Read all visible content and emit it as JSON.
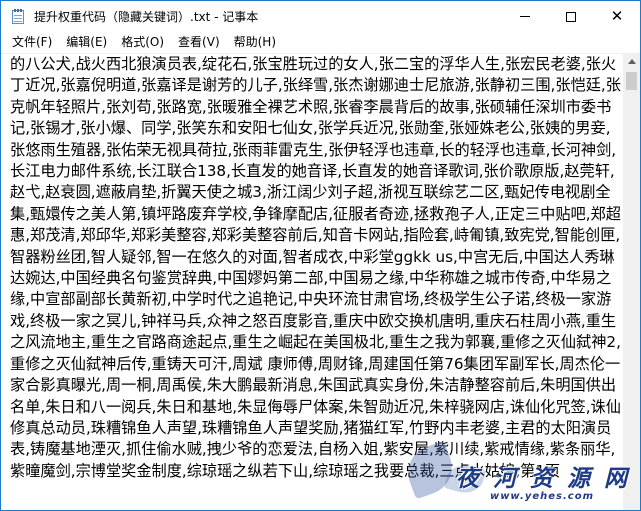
{
  "window": {
    "title": "提升权重代码（隐藏关键词）.txt - 记事本"
  },
  "menu": [
    {
      "label": "文件(F)"
    },
    {
      "label": "编辑(E)"
    },
    {
      "label": "格式(O)"
    },
    {
      "label": "查看(V)"
    },
    {
      "label": "帮助(H)"
    }
  ],
  "editor": {
    "content": "的八公犬,战火西北狼演员表,绽花石,张宝胜玩过的女人,张二宝的浮华人生,张宏民老婆,张火丁近况,张嘉倪明道,张嘉译是谢芳的儿子,张绎雪,张杰谢娜迪士尼旅游,张静初三围,张恺廷,张克帆年轻照片,张刘苟,张路宽,张暖雅全裸艺术照,张睿李晨背后的故事,张硕辅任深圳市委书记,张锡才,张小爆、同学,张笑东和安阳七仙女,张学兵近况,张勋奎,张娅姝老公,张姨的男妾,张悠雨生殖器,张佑荣无视具荷拉,张雨菲雷克生,张伊轻浮也违章,长的轻浮也违章,长河神剑,长江电力邮件系统,长江联合138,长直发的她音译,长直发的她音译歌词,张价歌原版,赵莞轩,赵弋,赵衰圆,遮蔽肩垫,折翼天使之城3,浙江阔少刘子超,浙视互联综艺二区,甄妃传电视剧全集,甄嬛传之美人第,镇坪路废弃学校,争锋摩配店,征服者奇迹,拯救孢子人,正定三中贴吧,郑超惠,郑茂清,郑邱华,郑彩美整容,郑彩美整容前后,知音卡网站,指险套,峙匍镇,致宪党,智能创匣,智器粉丝团,智人疑邻,智一在悠久的对面,智者成衣,中彩堂ggkk us,中宫无后,中国达人秀琳达婉达,中国经典名句鉴赏辞典,中国嫪妈第二部,中国易之缘,中华称雄之城市传奇,中华易之缘,中宣部副部长黄新初,中学时代之追艳记,中央环流甘肃官场,终极学生公子诺,终极一家游戏,终极一家之冥儿,钟祥马兵,众神之怒百度影音,重庆中欧交换机唐明,重庆石柱周小燕,重生之风流地主,重生之官路商途起点,重生之崛起在美国极北,重生之我为郭襄,重修之灭仙弑神2,重修之灭仙弑神后传,重铸天可汗,周斌 康师傅,周财锋,周建国任第76集团军副军长,周杰伦一家合影真曝光,周一桐,周禹侯,朱大鹏最新消息,朱国武真实身份,朱洁静整容前后,朱明国供出名单,朱日和八一阅兵,朱日和基地,朱显侮辱尸体案,朱智勋近况,朱梓骁网店,诛仙化咒签,诛仙修真总动员,珠糟锦鱼人声望,珠糟锦鱼人声望奖励,猪猫红军,竹野内丰老婆,主君的太阳演员表,铸魔基地湮灭,抓住偷水贼,拽少爷的恋爱法,自杨入姐,紫安屋,紫川续,紫戒情缘,紫条丽华,紫曈魔剑,宗博堂奖金制度,综琼瑶之纵若下山,综琼瑶之我要总裁,三点水姑娘,第1页"
  },
  "watermark": {
    "text": "夜 河 资 源 网",
    "url": "www.yehes.com"
  }
}
